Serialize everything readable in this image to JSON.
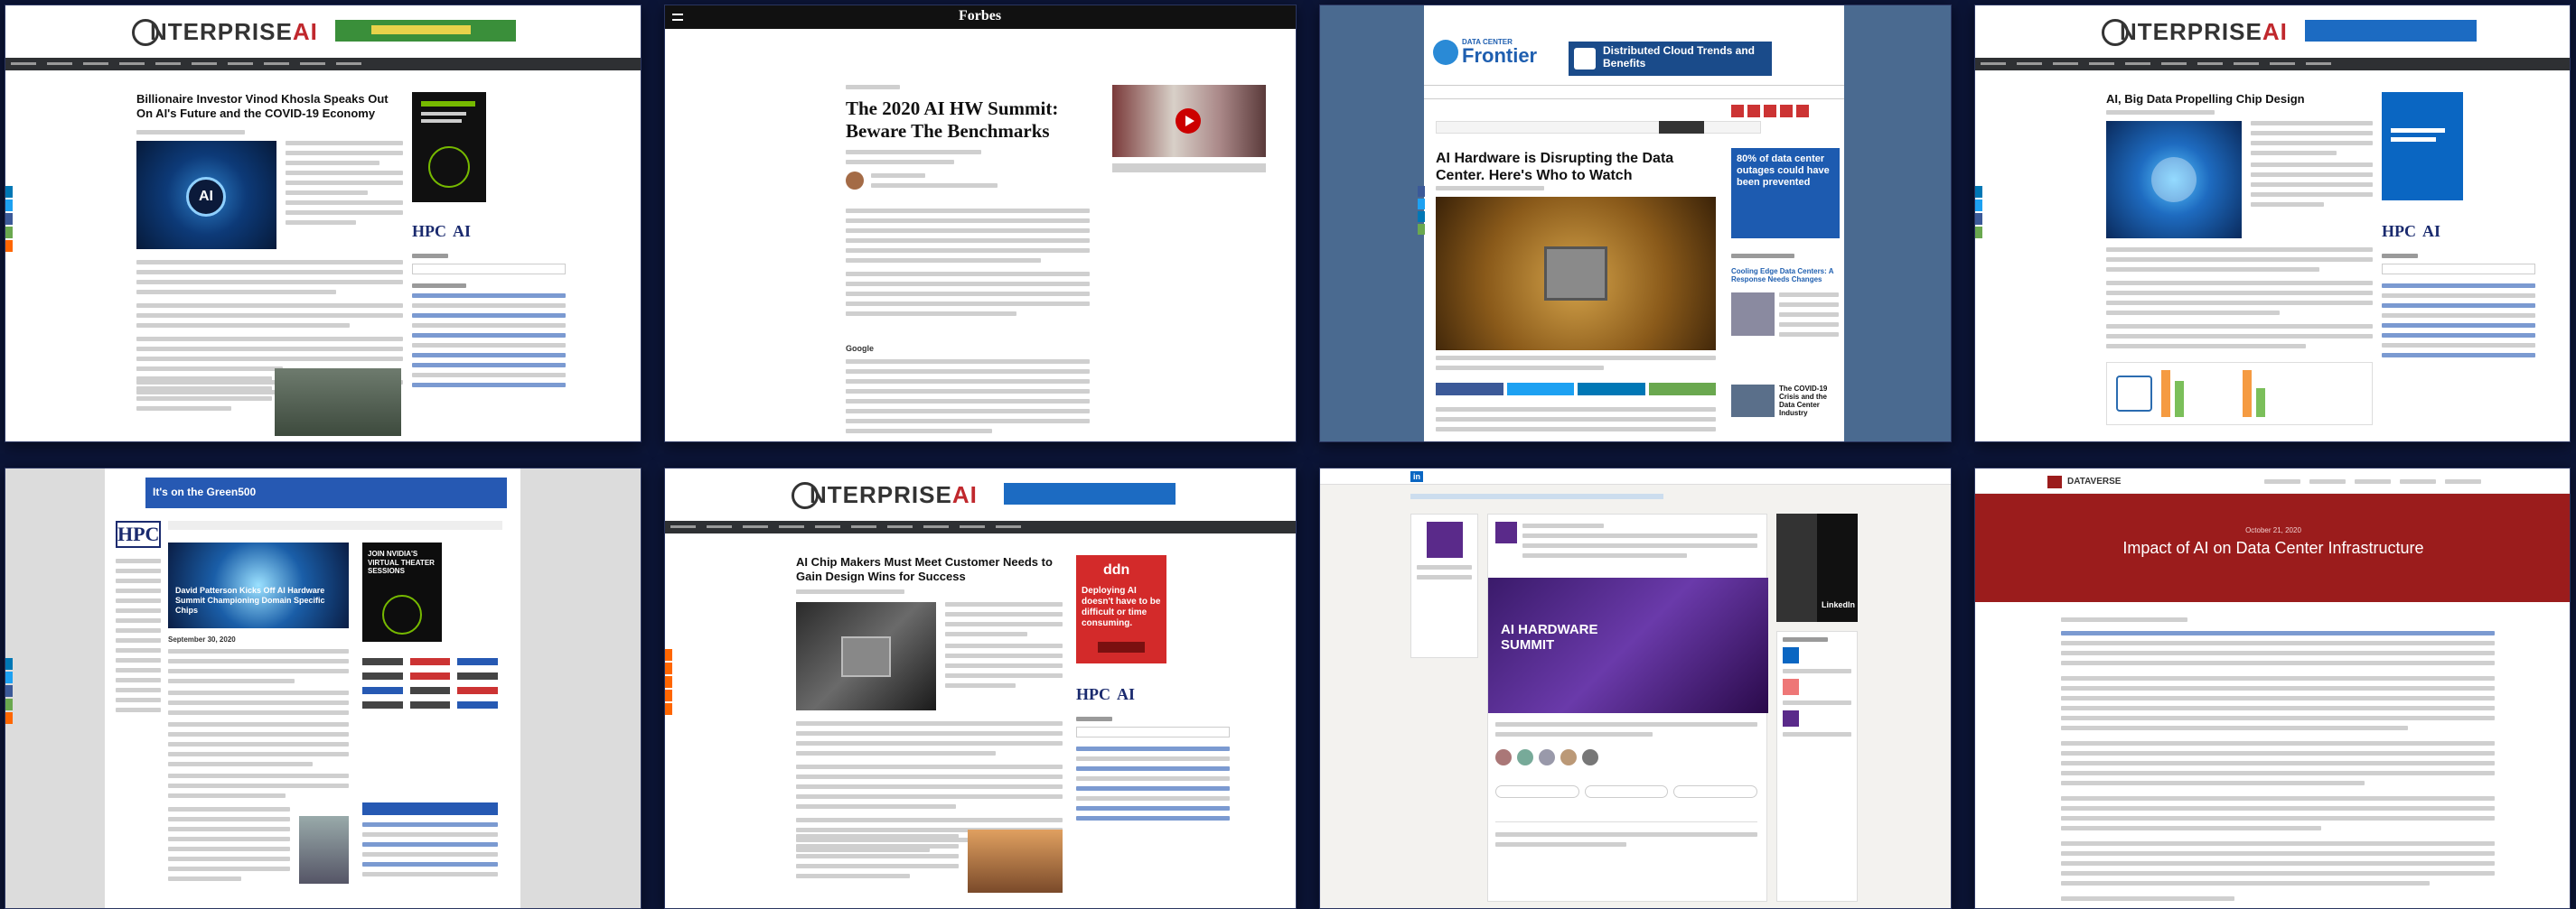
{
  "tiles": {
    "t1": {
      "logo_prefix": "NTERPRISE",
      "logo_accent": "AI",
      "headline": "Billionaire Investor Vinod Khosla Speaks Out On AI's Future and the COVID-19 Economy",
      "side_label": "HPC",
      "side_label2": "AI"
    },
    "t2": {
      "site": "Forbes",
      "headline": "The 2020 AI HW Summit: Beware The Benchmarks",
      "subhead_label": "Google"
    },
    "t3": {
      "brand_top": "DATA CENTER",
      "brand_main": "Frontier",
      "ad_text": "Distributed Cloud Trends and Benefits",
      "headline": "AI Hardware is Disrupting the Data Center. Here's Who to Watch",
      "side_stat": "80% of data center outages could have been prevented",
      "side_story1": "Cooling Edge Data Centers: A Response Needs Changes",
      "side_story2": "The COVID-19 Crisis and the Data Center Industry"
    },
    "t4": {
      "logo_prefix": "NTERPRISE",
      "logo_accent": "AI",
      "headline": "AI, Big Data Propelling Chip Design",
      "side_label": "HPC",
      "side_label2": "AI"
    },
    "t5": {
      "banner": "It's on the Green500",
      "logo": "HPC",
      "headline": "David Patterson Kicks Off AI Hardware Summit Championing Domain Specific Chips",
      "dateline": "September 30, 2020",
      "side_ad": "JOIN NVIDIA'S VIRTUAL THEATER SESSIONS"
    },
    "t6": {
      "logo_prefix": "NTERPRISE",
      "logo_accent": "AI",
      "headline": "AI Chip Makers Must Meet Customer Needs to Gain Design Wins for Success",
      "ad_brand": "ddn",
      "ad_text": "Deploying AI doesn't have to be difficult or time consuming.",
      "side_label": "HPC",
      "side_label2": "AI"
    },
    "t7": {
      "site": "in",
      "event": "AI HARDWARE SUMMIT",
      "side_text": "LinkedIn"
    },
    "t8": {
      "brand": "DATAVERSE",
      "title": "Impact of AI on Data Center Infrastructure",
      "date": "October 21, 2020"
    }
  },
  "colors": {
    "page_bg": "#0c1537",
    "enterprise_red": "#c0282d",
    "forbes_black": "#111111",
    "dcf_blue": "#1f5fb0",
    "hpc_navy": "#1a2a6e",
    "dataverse_red": "#9b1c1c",
    "linkedin_blue": "#0a66c2"
  },
  "icons": [
    "share-linkedin-icon",
    "share-twitter-icon",
    "share-facebook-icon",
    "share-email-icon",
    "play-icon",
    "menu-icon"
  ]
}
